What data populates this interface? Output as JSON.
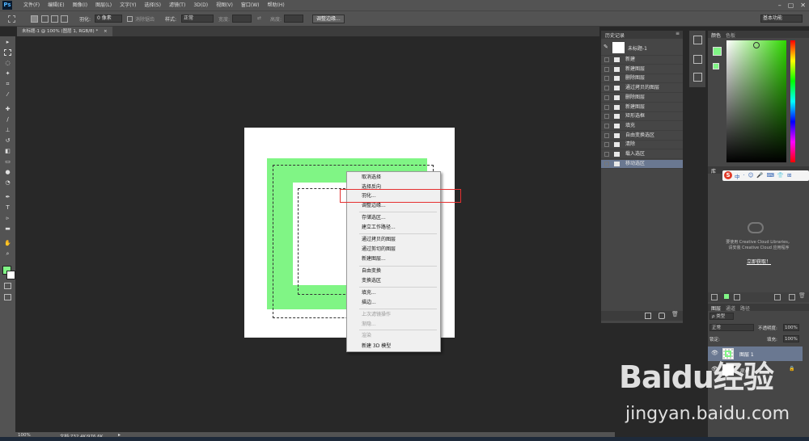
{
  "app": {
    "logo": "Ps"
  },
  "menubar": {
    "items": [
      "文件(F)",
      "编辑(E)",
      "图像(I)",
      "图层(L)",
      "文字(Y)",
      "选择(S)",
      "滤镜(T)",
      "3D(D)",
      "视图(V)",
      "窗口(W)",
      "帮助(H)"
    ],
    "window_controls": [
      "–",
      "▢",
      "✕"
    ]
  },
  "options_bar": {
    "feather_label": "羽化:",
    "feather_value": "0 像素",
    "antialias_label": "消除锯齿",
    "style_label": "样式:",
    "style_value": "正常",
    "width_label": "宽度:",
    "height_label": "高度:",
    "refine_edge_button": "调整边缘...",
    "workspace_value": "基本功能"
  },
  "document": {
    "tab_title": "未标题-1 @ 100% (图层 1, RGB/8) *",
    "tab_close": "×"
  },
  "context_menu": {
    "items": [
      {
        "label": "取消选择",
        "enabled": true
      },
      {
        "label": "选择反向",
        "enabled": true
      },
      {
        "label": "羽化...",
        "enabled": true,
        "highlighted": true
      },
      {
        "label": "调整边缘...",
        "enabled": true
      },
      {
        "label": "存储选区...",
        "enabled": true
      },
      {
        "label": "建立工作路径...",
        "enabled": true
      },
      {
        "label": "通过拷贝的图层",
        "enabled": true
      },
      {
        "label": "通过剪切的图层",
        "enabled": true
      },
      {
        "label": "新建图层...",
        "enabled": true
      },
      {
        "label": "自由变换",
        "enabled": true
      },
      {
        "label": "变换选区",
        "enabled": true
      },
      {
        "label": "填充...",
        "enabled": true
      },
      {
        "label": "描边...",
        "enabled": true
      },
      {
        "label": "上次滤镜操作",
        "enabled": false
      },
      {
        "label": "渐隐...",
        "enabled": false
      },
      {
        "label": "渲染",
        "enabled": false
      },
      {
        "label": "新建 3D 模型",
        "enabled": true
      }
    ]
  },
  "history_panel": {
    "title": "历史记录",
    "snapshot": "未标题-1",
    "states": [
      "新建",
      "新建图层",
      "删除图层",
      "通过拷贝的图层",
      "删除图层",
      "新建图层",
      "矩形选框",
      "填充",
      "自由变换选区",
      "清除",
      "载入选区",
      "移动选区"
    ],
    "active_index": 11
  },
  "color_panel": {
    "tabs": [
      "颜色",
      "色板"
    ],
    "foreground": "#80f585",
    "background": "#ffffff"
  },
  "libraries_panel": {
    "tab": "库",
    "ime_items": [
      "中",
      "·",
      "☺",
      "🎤",
      "⌨",
      "👕",
      "⊞"
    ],
    "message_line1": "要使用 Creative Cloud Libraries，",
    "message_line2": "请安装 Creative Cloud 应用程序",
    "link": "立即获取！"
  },
  "layers_panel": {
    "tabs": [
      "图层",
      "通道",
      "路径"
    ],
    "kind_label": "ρ 类型",
    "blend_mode": "正常",
    "opacity_label": "不透明度:",
    "opacity_value": "100%",
    "lock_label": "锁定:",
    "fill_label": "填充:",
    "fill_value": "100%",
    "layers": [
      {
        "name": "图层 1",
        "selected": true
      },
      {
        "name": "背景",
        "selected": false
      }
    ]
  },
  "status_bar": {
    "zoom": "100%",
    "doc_info": "文档:732.4K/976.6K"
  },
  "watermark": {
    "brand": "Baidu经验",
    "url": "jingyan.baidu.com"
  },
  "colors": {
    "accent_green": "#80f585",
    "highlight_red": "#e53030",
    "panel": "#464646",
    "chrome": "#535353"
  }
}
